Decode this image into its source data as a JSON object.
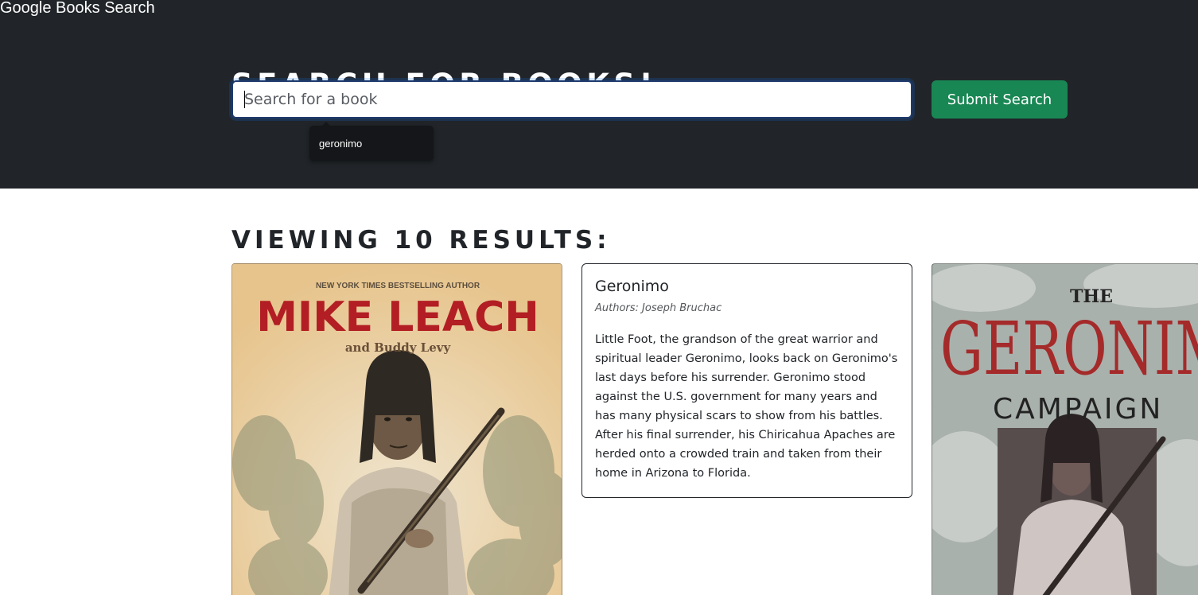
{
  "navbar": {
    "brand": "Google Books Search"
  },
  "hero": {
    "title": "SEARCH FOR BOOKS!",
    "search_placeholder": "Search for a book",
    "search_value": "",
    "submit_label": "Submit Search",
    "autocomplete_suggestion": "geronimo"
  },
  "results": {
    "heading": "VIEWING 10 RESULTS:",
    "books": [
      {
        "cover_top_line": "NEW YORK TIMES BESTSELLING AUTHOR",
        "cover_author": "MIKE LEACH",
        "cover_coauthor": "and Buddy Levy"
      },
      {
        "title": "Geronimo",
        "authors": "Authors: Joseph Bruchac",
        "description": "Little Foot, the grandson of the great warrior and spiritual leader Geronimo, looks back on Geronimo's last days before his surrender. Geronimo stood against the U.S. government for many years and has many physical scars to show from his battles. After his final surrender, his Chiricahua Apaches are herded onto a crowded train and taken from their home in Arizona to Florida."
      },
      {
        "cover_the": "THE",
        "cover_title": "GERONIMO",
        "cover_subtitle": "CAMPAIGN"
      }
    ]
  }
}
